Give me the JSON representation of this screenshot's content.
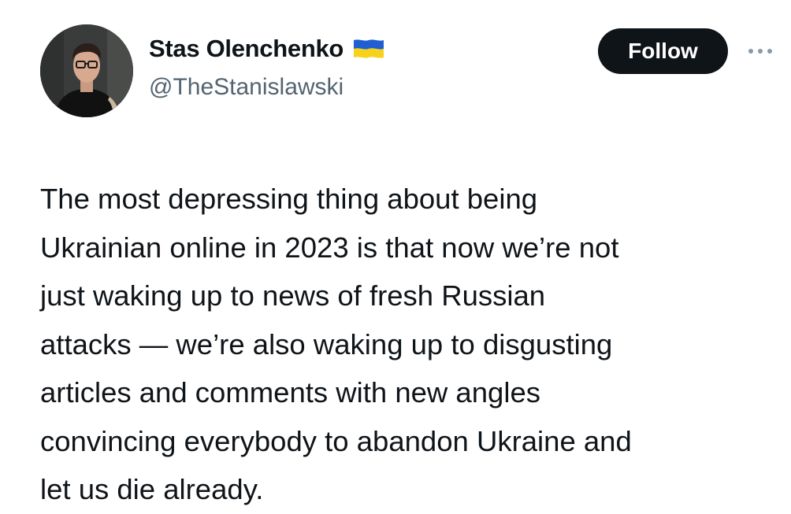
{
  "author": {
    "display_name": "Stas Olenchenko",
    "handle": "@TheStanislawski",
    "flag_icon": "ukraine-flag-icon",
    "flag_colors": [
      "#1f5fd1",
      "#f7d21a"
    ]
  },
  "actions": {
    "follow_label": "Follow",
    "more_icon": "more-options-icon"
  },
  "tweet": {
    "lines": [
      "The most depressing thing about being",
      "Ukrainian online in 2023 is that now we’re not",
      "just waking up to news of fresh Russian",
      "attacks — we’re also waking up to disgusting",
      "articles and comments with new angles",
      "convincing everybody to abandon Ukraine and",
      "let us die already."
    ]
  },
  "colors": {
    "text": "#0f1419",
    "secondary_text": "#536471",
    "button_bg": "#0f1419",
    "button_text": "#ffffff"
  }
}
